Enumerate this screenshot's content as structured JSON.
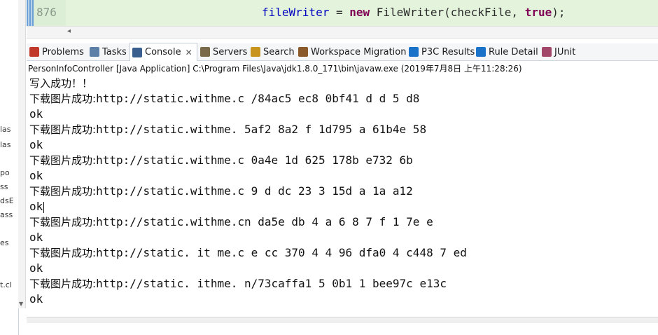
{
  "left_fragments": [
    "las",
    "las",
    "po",
    "ss",
    "dsE",
    "ass",
    "es",
    "t.cl"
  ],
  "editor": {
    "line_number": "876",
    "code": {
      "indent": "",
      "var": "fileWriter",
      "eq": " = ",
      "kw_new": "new",
      "cls": " FileWriter(checkFile, ",
      "kw_true": "true",
      "end": ");"
    }
  },
  "tabs": [
    {
      "label": "Problems",
      "icon": "problems-icon",
      "color": "#c0392b"
    },
    {
      "label": "Tasks",
      "icon": "tasks-icon",
      "color": "#5b7fa6"
    },
    {
      "label": "Console",
      "icon": "console-icon",
      "color": "#3a5f8f",
      "active": true
    },
    {
      "label": "Servers",
      "icon": "servers-icon",
      "color": "#7a6a4a"
    },
    {
      "label": "Search",
      "icon": "search-icon",
      "color": "#c8941e"
    },
    {
      "label": "Workspace Migration",
      "icon": "workspace-migration-icon",
      "color": "#8a5a2a"
    },
    {
      "label": "P3C Results",
      "icon": "p3c-icon",
      "color": "#1a73c8"
    },
    {
      "label": "Rule Detail",
      "icon": "rule-detail-icon",
      "color": "#1a73c8"
    },
    {
      "label": "JUnit",
      "icon": "junit-icon",
      "color": "#a3476a"
    }
  ],
  "console": {
    "launch_label": "PersonInfoController [Java Application] C:\\Program Files\\Java\\jdk1.8.0_171\\bin\\javaw.exe (2019年7月8日 上午11:28:26)",
    "lines": [
      {
        "cjk": "写入成功！！",
        "text": ""
      },
      {
        "cjk": "下载图片成功:",
        "text": "http://static.withme.c  /84ac5 ec8   0bf41   d    d  5   d8"
      },
      {
        "cjk": "",
        "text": "ok"
      },
      {
        "cjk": "下载图片成功:",
        "text": "http://static.withme.  5af2   8a2  f  1d795 a  61b4e 58"
      },
      {
        "cjk": "",
        "text": "ok"
      },
      {
        "cjk": "下载图片成功:",
        "text": "http://static.withme.c   0a4e 1d  625     178b    e732 6b"
      },
      {
        "cjk": "",
        "text": "ok"
      },
      {
        "cjk": "下载图片成功:",
        "text": "http://static.withme.c  9  d dc   23   3   15d   a  1a   a12"
      },
      {
        "cjk": "",
        "text": "ok"
      },
      {
        "cjk": "下载图片成功:",
        "text": "http://static.withme.cn da5e db 4 a  6    8  7  f  1   7e e"
      },
      {
        "cjk": "",
        "text": "ok"
      },
      {
        "cjk": "下载图片成功:",
        "text": "http://static. it me.c  e cc  370 4 4 96  dfa0  4 c448  7 ed"
      },
      {
        "cjk": "",
        "text": "ok"
      },
      {
        "cjk": "下载图片成功:",
        "text": "http://static. ithme. n/73caffa1   5  0b1  1 bee97c  e13c"
      },
      {
        "cjk": "",
        "text": "ok"
      }
    ]
  }
}
